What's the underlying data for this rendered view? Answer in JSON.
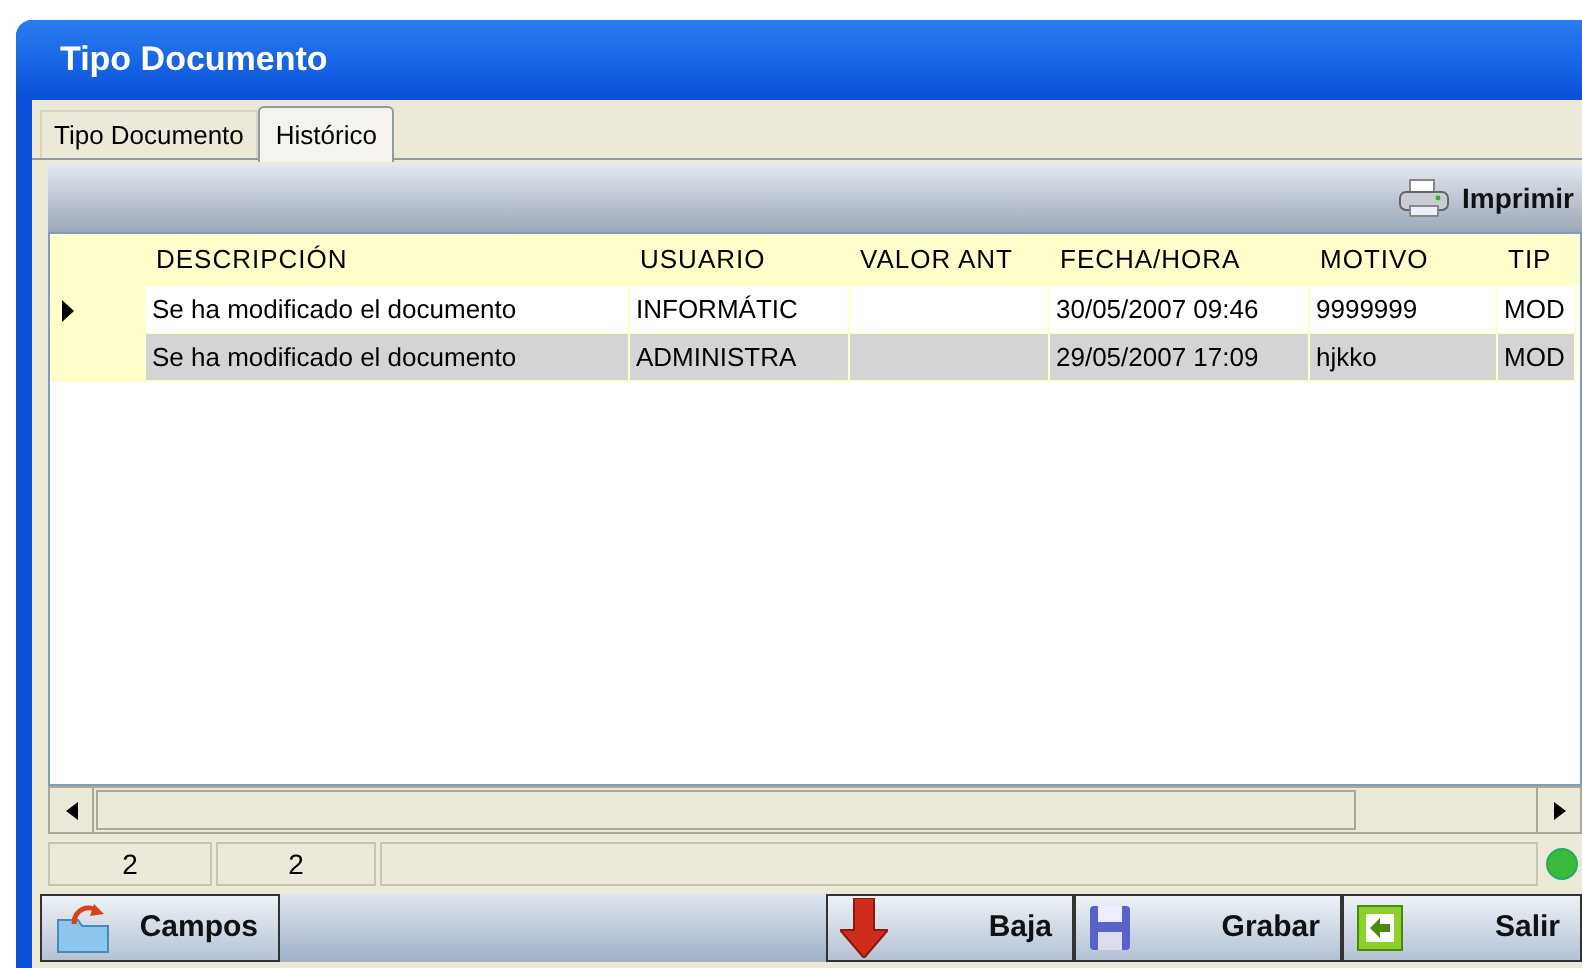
{
  "window": {
    "title": "Tipo Documento"
  },
  "tabs": [
    {
      "label": "Tipo Documento",
      "selected": false
    },
    {
      "label": "Histórico",
      "selected": true
    }
  ],
  "toolbar": {
    "print_button": "Imprimir"
  },
  "table": {
    "columns": [
      "DESCRIPCIÓN",
      "USUARIO",
      "VALOR ANT",
      "FECHA/HORA",
      "MOTIVO",
      "TIP"
    ],
    "rows": [
      {
        "selected": true,
        "cells": [
          "Se ha modificado el documento",
          "INFORMÁTIC",
          "",
          "30/05/2007 09:46",
          "9999999",
          "MOD"
        ]
      },
      {
        "selected": false,
        "cells": [
          "Se ha modificado el documento",
          "ADMINISTRA",
          "",
          "29/05/2007 17:09",
          "hjkko",
          "MOD"
        ]
      }
    ]
  },
  "status_bar": {
    "fields": [
      "2",
      "2"
    ],
    "connected": true
  },
  "buttons": [
    {
      "kind": "fields",
      "label": "Campos"
    },
    {
      "kind": "delete",
      "label": "Baja"
    },
    {
      "kind": "save",
      "label": "Grabar"
    },
    {
      "kind": "exit",
      "label": "Salir"
    }
  ]
}
